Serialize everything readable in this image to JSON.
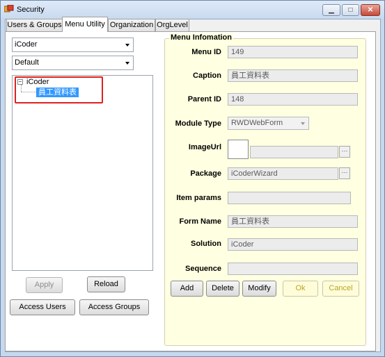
{
  "window": {
    "title": "Security"
  },
  "tabs": [
    {
      "label": "Users & Groups"
    },
    {
      "label": "Menu Utility"
    },
    {
      "label": "Organization"
    },
    {
      "label": "OrgLevel"
    }
  ],
  "left": {
    "combo1": "iCoder",
    "combo2": "Default",
    "tree": {
      "root": "iCoder",
      "child": "員工資料表"
    },
    "buttons": {
      "apply": "Apply",
      "reload": "Reload",
      "access_users": "Access Users",
      "access_groups": "Access Groups"
    }
  },
  "menu_info": {
    "title": "Menu Infomation",
    "labels": {
      "menu_id": "Menu ID",
      "caption": "Caption",
      "parent_id": "Parent ID",
      "module_type": "Module Type",
      "image_url": "ImageUrl",
      "package": "Package",
      "item_params": "Item params",
      "form_name": "Form Name",
      "solution": "Solution",
      "sequence": "Sequence"
    },
    "values": {
      "menu_id": "149",
      "caption": "員工資料表",
      "parent_id": "148",
      "module_type": "RWDWebForm",
      "image_url": "",
      "package": "iCoderWizard",
      "item_params": "",
      "form_name": "員工資料表",
      "solution": "iCoder",
      "sequence": ""
    },
    "ellipsis": "···",
    "buttons": {
      "add": "Add",
      "delete": "Delete",
      "modify": "Modify",
      "ok": "Ok",
      "cancel": "Cancel"
    }
  },
  "caption_buttons": {
    "minimize": "▁",
    "maximize": "□",
    "close": "✕"
  }
}
